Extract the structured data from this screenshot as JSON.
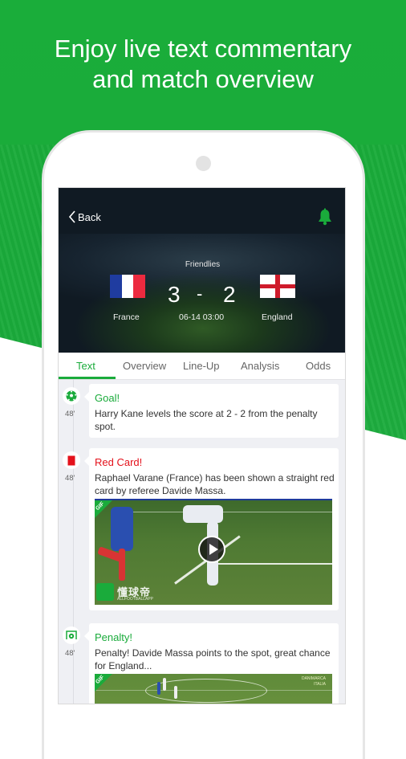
{
  "promo": {
    "headline_line1": "Enjoy live text commentary",
    "headline_line2": "and match overview"
  },
  "colors": {
    "brand_green": "#1aab3b",
    "red_card": "#e4111b",
    "nav_dark": "#101a23"
  },
  "navbar": {
    "back_label": "Back",
    "back_icon": "chevron-left-icon",
    "notify_icon": "bell-icon"
  },
  "match": {
    "league": "Friendlies",
    "home_team": "France",
    "away_team": "England",
    "home_score": "3",
    "separator": "-",
    "away_score": "2",
    "kickoff": "06-14 03:00"
  },
  "tabs": [
    {
      "label": "Text",
      "active": true
    },
    {
      "label": "Overview",
      "active": false
    },
    {
      "label": "Line-Up",
      "active": false
    },
    {
      "label": "Analysis",
      "active": false
    },
    {
      "label": "Odds",
      "active": false
    }
  ],
  "events": [
    {
      "type": "goal",
      "icon": "soccer-ball-icon",
      "minute": "48'",
      "title": "Goal!",
      "text": "Harry Kane levels the score at 2 - 2 from the penalty spot."
    },
    {
      "type": "red-card",
      "icon": "red-card-icon",
      "minute": "48'",
      "title": "Red Card!",
      "text": "Raphael Varane (France) has been shown a straight red card by referee Davide Massa.",
      "media_tag": "GIF",
      "watermark": "懂球帝",
      "watermark_sub": "ALLFOOTBALLAPP"
    },
    {
      "type": "penalty",
      "icon": "penalty-goal-icon",
      "minute": "48'",
      "title": "Penalty!",
      "text": "Penalty! Davide Massa points to the spot, great chance for England...",
      "media_tag": "GIF",
      "scorebug_line1": "DANIMARCA",
      "scorebug_line2": "ITALIA"
    }
  ]
}
